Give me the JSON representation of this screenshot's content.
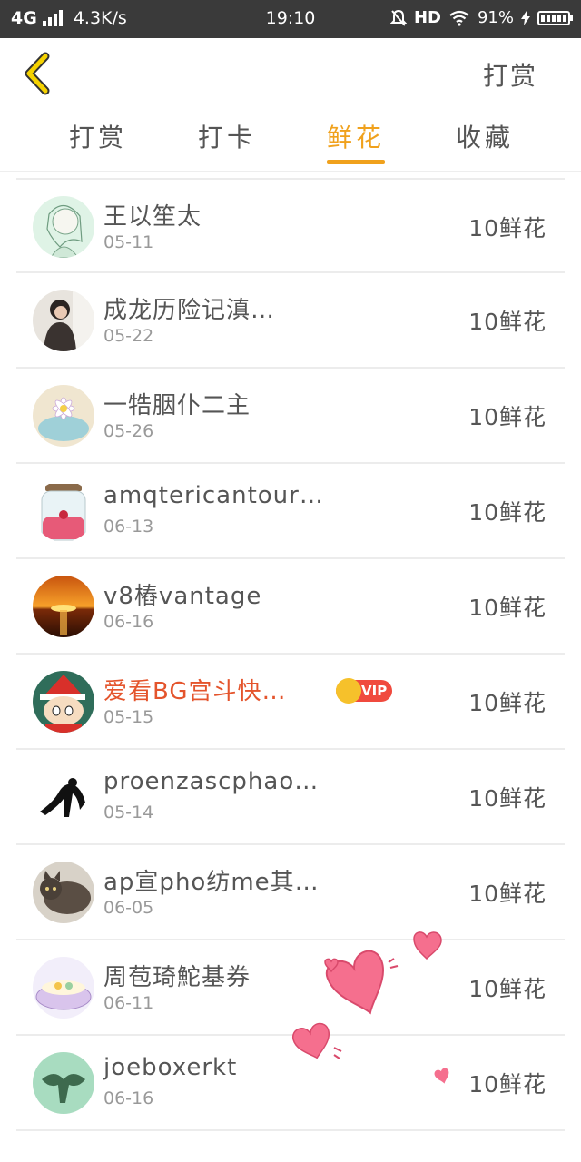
{
  "status_bar": {
    "network": "4G",
    "speed": "4.3K/s",
    "time": "19:10",
    "hd": "HD",
    "battery": "91%"
  },
  "header": {
    "right_action": "打赏"
  },
  "tabs": [
    {
      "label": "打赏",
      "active": false
    },
    {
      "label": "打卡",
      "active": false
    },
    {
      "label": "鲜花",
      "active": true
    },
    {
      "label": "收藏",
      "active": false
    }
  ],
  "colors": {
    "accent": "#f0a11c",
    "vip_name": "#e4542c",
    "vip_badge": "#f04a3e"
  },
  "rows": [
    {
      "name": "王以笙太",
      "date": "05-11",
      "amount": "10鲜花",
      "avatar": "anime-girl-sketch-avatar",
      "vip": false
    },
    {
      "name": "成龙历险记滇…",
      "date": "05-22",
      "amount": "10鲜花",
      "avatar": "girl-photo-avatar",
      "vip": false
    },
    {
      "name": "一牿胭仆二主",
      "date": "05-26",
      "amount": "10鲜花",
      "avatar": "flower-bowl-avatar",
      "vip": false
    },
    {
      "name": "amqtericantour…",
      "date": "06-13",
      "amount": "10鲜花",
      "avatar": "jar-rose-avatar",
      "vip": false
    },
    {
      "name": "v8樁vantage",
      "date": "06-16",
      "amount": "10鲜花",
      "avatar": "sunset-avatar",
      "vip": false
    },
    {
      "name": "爱看BG宫斗快…",
      "date": "05-15",
      "amount": "10鲜花",
      "avatar": "cartoon-boy-avatar",
      "vip": true,
      "badge": "VIP"
    },
    {
      "name": "proenzascphao…",
      "date": "05-14",
      "amount": "10鲜花",
      "avatar": "ink-silhouette-avatar",
      "vip": false
    },
    {
      "name": "ap宣pho纺me其…",
      "date": "06-05",
      "amount": "10鲜花",
      "avatar": "cat-photo-avatar",
      "vip": false
    },
    {
      "name": "周苞琦鮀基券",
      "date": "06-11",
      "amount": "10鲜花",
      "avatar": "dessert-bowl-avatar",
      "vip": false
    },
    {
      "name": "joeboxerkt",
      "date": "06-16",
      "amount": "10鲜花",
      "avatar": "green-figure-avatar",
      "vip": false
    }
  ]
}
